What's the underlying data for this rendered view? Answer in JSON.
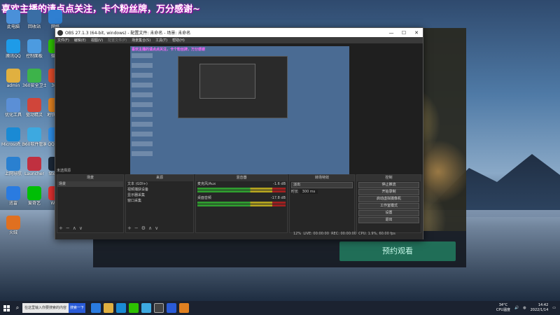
{
  "banner": "喜欢主播的请点点关注，卡个粉丝牌，万分感谢~",
  "desktop_icons": [
    {
      "label": "此电脑",
      "color": "#4a90d9"
    },
    {
      "label": "回收站",
      "color": "#3a6ea5"
    },
    {
      "label": "网络",
      "color": "#2f7fd1"
    },
    {
      "label": "腾讯QQ",
      "color": "#1e9be8"
    },
    {
      "label": "控制面板",
      "color": "#4c9be0"
    },
    {
      "label": "微信",
      "color": "#2dc100"
    },
    {
      "label": "admin",
      "color": "#e0b040"
    },
    {
      "label": "360安全卫士",
      "color": "#3db34a"
    },
    {
      "label": "360",
      "color": "#e24b2a"
    },
    {
      "label": "优化工具",
      "color": "#5b8fd6"
    },
    {
      "label": "驱动精灵",
      "color": "#d0453a"
    },
    {
      "label": "地铁跑酷",
      "color": "#e08020"
    },
    {
      "label": "Microsoft Edge",
      "color": "#1a8ad4"
    },
    {
      "label": "360软件管家",
      "color": "#3da9e0"
    },
    {
      "label": "QQ天气",
      "color": "#2d8ee8"
    },
    {
      "label": "上网导航",
      "color": "#2a80d0"
    },
    {
      "label": "Launcher",
      "color": "#c03040"
    },
    {
      "label": "Steam",
      "color": "#1b2838"
    },
    {
      "label": "迅雷",
      "color": "#2a7be0"
    },
    {
      "label": "爱奇艺",
      "color": "#00be06"
    },
    {
      "label": "WPS",
      "color": "#e03030"
    },
    {
      "label": "火绒",
      "color": "#e07020"
    }
  ],
  "obs": {
    "title": "OBS 27.1.3 (64-bit, windows) - 配置文件: 未命名 - 场景: 未命名",
    "menu": [
      "文件(F)",
      "编辑(E)",
      "视图(V)",
      "配置文件(P)",
      "场景集合(S)",
      "工具(T)",
      "帮助(H)"
    ],
    "canvas_banner": "喜欢主播的请点点关注，卡个粉丝牌，万分感谢",
    "no_source": "未选择源",
    "docks": {
      "scenes": {
        "title": "场景",
        "items": [
          "场景"
        ]
      },
      "sources": {
        "title": "来源",
        "items": [
          "文本 (GDI+)",
          "视频捕获设备",
          "显示器采集",
          "窗口采集"
        ]
      },
      "mixer": {
        "title": "混音器",
        "tracks": [
          {
            "name": "麦克风/Aux",
            "level": "-1.6 dB"
          },
          {
            "name": "桌面音频",
            "level": "-17.8 dB"
          }
        ]
      },
      "transitions": {
        "title": "转场特效",
        "type": "淡出",
        "duration_label": "时长",
        "duration": "300 ms"
      },
      "controls": {
        "title": "控制",
        "buttons": [
          "停止推流",
          "开始录制",
          "启动虚拟摄像机",
          "工作室模式",
          "设置",
          "退出"
        ]
      }
    },
    "status": {
      "live": "LIVE: 00:00:00",
      "rec": "REC: 00:00:00",
      "cpu": "CPU: 1.9%, 60.00 fps",
      "dropped": "12%"
    }
  },
  "backdrop_app": {
    "button": "预约观看"
  },
  "taskbar": {
    "search_placeholder": "在这里输入你要搜索的内容",
    "baidu": "搜索一下",
    "weather_temp": "34°C",
    "weather_desc": "CPU温度",
    "time": "14:42",
    "date": "2022/1/14"
  }
}
